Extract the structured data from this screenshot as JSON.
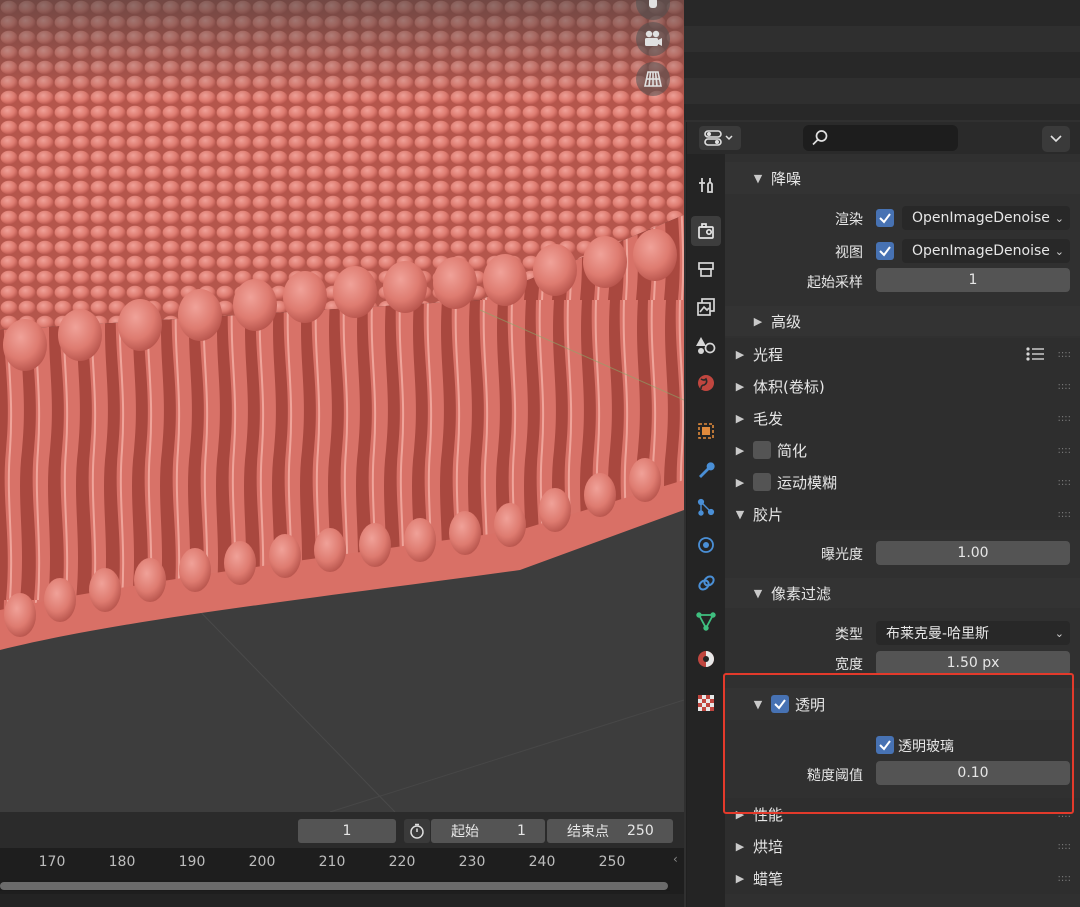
{
  "viewport": {
    "icons": [
      "hand-icon",
      "camera-icon",
      "grid-icon"
    ]
  },
  "timeline": {
    "current_frame": "1",
    "start_label": "起始",
    "start_value": "1",
    "end_label": "结束点",
    "end_value": "250",
    "ticks": [
      "170",
      "180",
      "190",
      "200",
      "210",
      "220",
      "230",
      "240",
      "250"
    ]
  },
  "properties": {
    "search_placeholder": "",
    "denoise": {
      "title": "降噪",
      "render_label": "渲染",
      "render_value": "OpenImageDenoise",
      "viewport_label": "视图",
      "viewport_value": "OpenImageDenoise",
      "start_sample_label": "起始采样",
      "start_sample_value": "1",
      "advanced_title": "高级"
    },
    "light_paths": "光程",
    "volumes": "体积(卷标)",
    "hair": "毛发",
    "simplify": "简化",
    "motion_blur": "运动模糊",
    "film": {
      "title": "胶片",
      "exposure_label": "曝光度",
      "exposure_value": "1.00",
      "pixel_filter_title": "像素过滤",
      "type_label": "类型",
      "type_value": "布莱克曼-哈里斯",
      "width_label": "宽度",
      "width_value": "1.50 px",
      "transparent_title": "透明",
      "transparent_glass_label": "透明玻璃",
      "roughness_label": "糙度阈值",
      "roughness_value": "0.10"
    },
    "performance": "性能",
    "bake": "烘培",
    "grease_pencil": "蜡笔"
  },
  "colors": {
    "highlight": "#e33a2b",
    "checkbox_on": "#4772b3",
    "membrane": "#de7b70"
  }
}
